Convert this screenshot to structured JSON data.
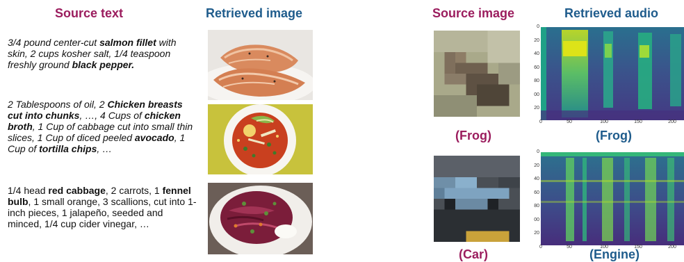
{
  "headers": {
    "source_text": "Source text",
    "retrieved_image": "Retrieved image",
    "source_image": "Source image",
    "retrieved_audio": "Retrieved audio"
  },
  "recipes": [
    {
      "segments": [
        {
          "t": "3/4 pound center-cut ",
          "b": false
        },
        {
          "t": "salmon fillet",
          "b": true
        },
        {
          "t": " with skin, 2 cups kosher salt, 1/4 teaspoon freshly ground ",
          "b": false
        },
        {
          "t": "black pepper.",
          "b": true
        }
      ]
    },
    {
      "segments": [
        {
          "t": "2 Tablespoons of oil, 2 ",
          "b": false
        },
        {
          "t": "Chicken breasts cut into chunks",
          "b": true
        },
        {
          "t": ", …, 4 Cups of ",
          "b": false
        },
        {
          "t": "chicken broth",
          "b": true
        },
        {
          "t": ", 1 Cup of cabbage cut into small thin slices, 1 Cup of diced peeled ",
          "b": false
        },
        {
          "t": "avocado",
          "b": true
        },
        {
          "t": ", 1 Cup of ",
          "b": false
        },
        {
          "t": "tortilla chips",
          "b": true
        },
        {
          "t": ", …",
          "b": false
        }
      ]
    },
    {
      "segments": [
        {
          "t": "1/4 head ",
          "b": false
        },
        {
          "t": "red cabbage",
          "b": true
        },
        {
          "t": ", 2 carrots, 1 ",
          "b": false
        },
        {
          "t": "fennel bulb",
          "b": true
        },
        {
          "t": ", 1 small orange, 3 scallions, cut into 1-inch pieces, 1 jalapeño, seeded and minced, 1/4 cup cider vinegar, …",
          "b": false
        }
      ]
    }
  ],
  "captions": {
    "frog_source": "(Frog)",
    "frog_audio": "(Frog)",
    "car_source": "(Car)",
    "engine_audio": "(Engine)"
  },
  "spectrogram": {
    "yticks": [
      "0",
      "20",
      "40",
      "60",
      "80",
      "00",
      "20"
    ],
    "xticks": [
      "0",
      "50",
      "100",
      "150",
      "200"
    ]
  },
  "colors": {
    "magenta": "#9b1d5e",
    "blue": "#1f5c8c"
  }
}
